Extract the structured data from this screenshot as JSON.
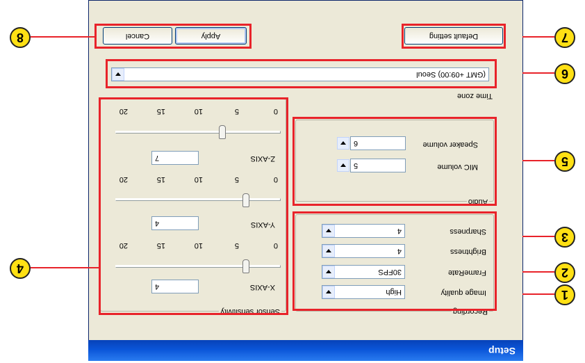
{
  "window": {
    "title": "Setup"
  },
  "recording": {
    "legend": "Recording",
    "image_quality_label": "Image quality",
    "image_quality": "High",
    "framerate_label": "FrameRate",
    "framerate": "30FPS",
    "brightness_label": "Brightness",
    "brightness": "4",
    "sharpness_label": "Sharpness",
    "sharpness": "4"
  },
  "audio": {
    "legend": "Audio",
    "mic_label": "MIC volume",
    "mic": "5",
    "speaker_label": "Speaker volume",
    "speaker": "6"
  },
  "timezone": {
    "label": "Time zone",
    "value": "(GMT +09:00) Seoul"
  },
  "sensor": {
    "legend": "Sensor sensitivity",
    "x_label": "X-AXIS",
    "x": "4",
    "y_label": "Y-AXIS",
    "y": "4",
    "z_label": "Z-AXIS",
    "z": "7",
    "ticks": [
      "0",
      "5",
      "10",
      "15",
      "20"
    ]
  },
  "buttons": {
    "default": "Default setting",
    "apply": "Apply",
    "cancel": "Cancel"
  },
  "callouts": [
    "1",
    "2",
    "3",
    "4",
    "5",
    "6",
    "7",
    "8"
  ],
  "colors": {
    "titlebar": "#0a55d8",
    "highlight": "#e8232a",
    "callout": "#ffe014"
  }
}
